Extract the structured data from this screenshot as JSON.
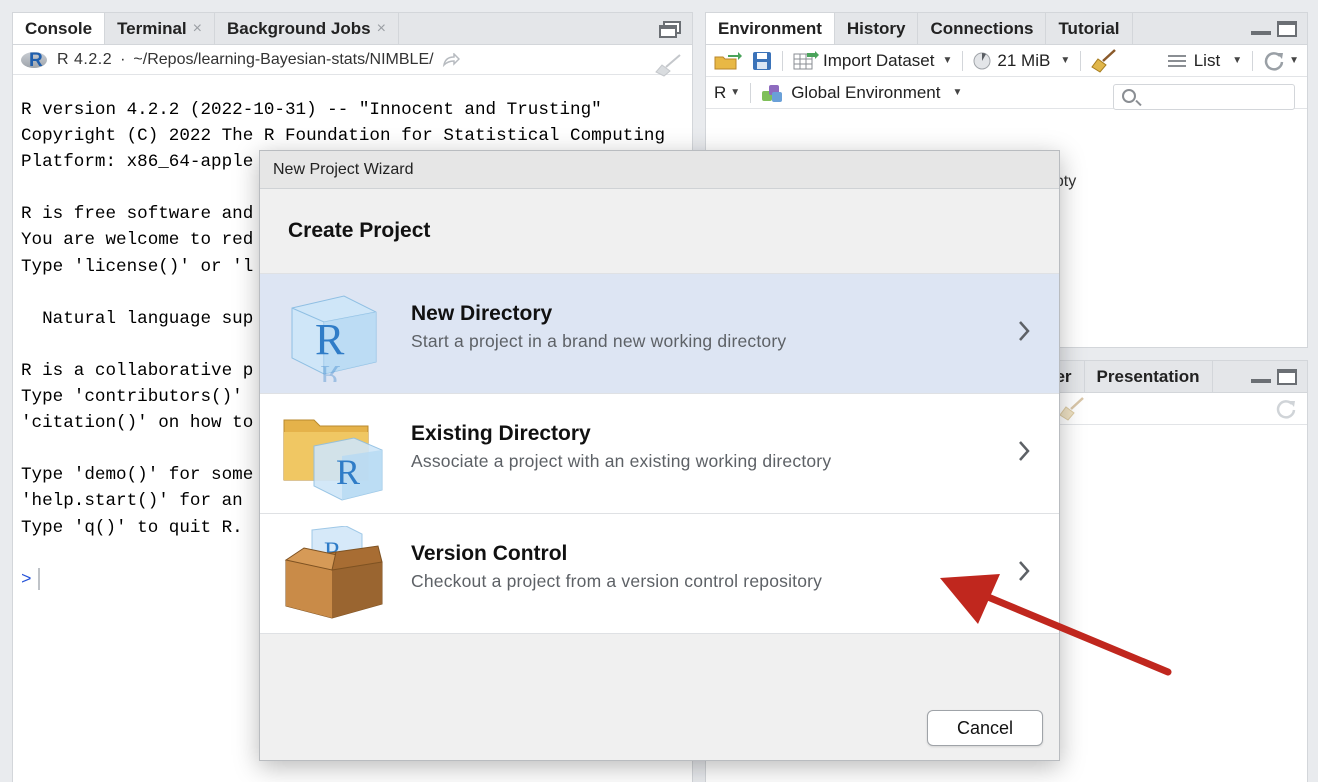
{
  "left_pane": {
    "tabs": [
      {
        "label": "Console",
        "closable": false
      },
      {
        "label": "Terminal",
        "closable": true
      },
      {
        "label": "Background Jobs",
        "closable": true
      }
    ],
    "r_version": "R 4.2.2",
    "separator": "·",
    "working_dir": "~/Repos/learning-Bayesian-stats/NIMBLE/",
    "console_lines": [
      "R version 4.2.2 (2022-10-31) -- \"Innocent and Trusting\"",
      "Copyright (C) 2022 The R Foundation for Statistical Computing",
      "Platform: x86_64-apple",
      "",
      "R is free software and",
      "You are welcome to red",
      "Type 'license()' or 'l",
      "",
      "  Natural language sup",
      "",
      "R is a collaborative p",
      "Type 'contributors()'",
      "'citation()' on how to",
      "",
      "Type 'demo()' for some",
      "'help.start()' for an",
      "Type 'q()' to quit R.",
      ""
    ],
    "prompt": ">",
    "close_glyph": "×"
  },
  "env_pane": {
    "tabs": [
      "Environment",
      "History",
      "Connections",
      "Tutorial"
    ],
    "toolbar": {
      "import_dataset": "Import Dataset",
      "memory": "21 MiB",
      "view_mode": "List",
      "language": "R",
      "scope": "Global Environment"
    },
    "empty_text_visible": "npty"
  },
  "viewer_pane": {
    "tabs_visible": [
      "ver",
      "Presentation"
    ]
  },
  "wizard": {
    "window_title": "New Project Wizard",
    "heading": "Create Project",
    "options": [
      {
        "title": "New Directory",
        "description": "Start a project in a brand new working directory",
        "selected": true,
        "icon": "r-cube-icon"
      },
      {
        "title": "Existing Directory",
        "description": "Associate a project with an existing working directory",
        "selected": false,
        "icon": "folder-r-icon"
      },
      {
        "title": "Version Control",
        "description": "Checkout a project from a version control repository",
        "selected": false,
        "icon": "box-icon"
      }
    ],
    "cancel_label": "Cancel"
  },
  "annotation": {
    "type": "arrow",
    "color": "#c0271e",
    "points_to": "Version Control"
  },
  "colors": {
    "selected_row": "#dde5f3",
    "prompt": "#2452d8",
    "r_blue": "#1f5fae"
  }
}
